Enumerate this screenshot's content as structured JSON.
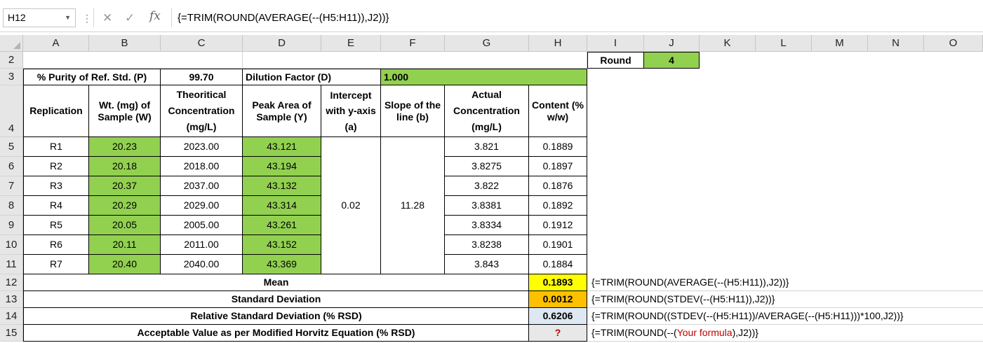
{
  "formula_bar": {
    "name_box": "H12",
    "fx_label": "fx",
    "formula": "{=TRIM(ROUND(AVERAGE(--(H5:H11)),J2))}"
  },
  "columns": [
    "A",
    "B",
    "C",
    "D",
    "E",
    "F",
    "G",
    "H",
    "I",
    "J",
    "K",
    "L",
    "M",
    "N",
    "O"
  ],
  "rows": [
    "2",
    "3",
    "4",
    "5",
    "6",
    "7",
    "8",
    "9",
    "10",
    "11",
    "12",
    "13",
    "14",
    "15"
  ],
  "round": {
    "label": "Round",
    "value": "4"
  },
  "purity": {
    "label": "% Purity of Ref. Std. (P)",
    "value": "99.70"
  },
  "dilution": {
    "label": "Dilution Factor (D)",
    "value": "1.000"
  },
  "headers": {
    "replication": "Replication",
    "weight": "Wt. (mg) of Sample (W)",
    "theoretical": "Theoritical Concentration (mg/L)",
    "peak_area": "Peak Area of Sample (Y)",
    "intercept": "Intercept with y-axis (a)",
    "slope": "Slope of the line (b)",
    "actual": "Actual Concentration (mg/L)",
    "content": "Content (% w/w)"
  },
  "data_rows": [
    {
      "rep": "R1",
      "wt": "20.23",
      "theo": "2023.00",
      "peak": "43.121",
      "actual": "3.821",
      "content": "0.1889"
    },
    {
      "rep": "R2",
      "wt": "20.18",
      "theo": "2018.00",
      "peak": "43.194",
      "actual": "3.8275",
      "content": "0.1897"
    },
    {
      "rep": "R3",
      "wt": "20.37",
      "theo": "2037.00",
      "peak": "43.132",
      "actual": "3.822",
      "content": "0.1876"
    },
    {
      "rep": "R4",
      "wt": "20.29",
      "theo": "2029.00",
      "peak": "43.314",
      "actual": "3.8381",
      "content": "0.1892"
    },
    {
      "rep": "R5",
      "wt": "20.05",
      "theo": "2005.00",
      "peak": "43.261",
      "actual": "3.8334",
      "content": "0.1912"
    },
    {
      "rep": "R6",
      "wt": "20.11",
      "theo": "2011.00",
      "peak": "43.152",
      "actual": "3.8238",
      "content": "0.1901"
    },
    {
      "rep": "R7",
      "wt": "20.40",
      "theo": "2040.00",
      "peak": "43.369",
      "actual": "3.843",
      "content": "0.1884"
    }
  ],
  "intercept_value": "0.02",
  "slope_value": "11.28",
  "summary": [
    {
      "label": "Mean",
      "value": "0.1893",
      "formula": "{=TRIM(ROUND(AVERAGE(--(H5:H11)),J2))}"
    },
    {
      "label": "Standard Deviation",
      "value": "0.0012",
      "formula": "{=TRIM(ROUND(STDEV(--(H5:H11)),J2))}"
    },
    {
      "label": "Relative Standard Deviation (% RSD)",
      "value": "0.6206",
      "formula": "{=TRIM(ROUND((STDEV(--(H5:H11))/AVERAGE(--(H5:H11)))*100,J2))}"
    },
    {
      "label": "Acceptable Value as per Modified Horvitz Equation (% RSD)",
      "value": "?",
      "formula_pre": "{=TRIM(ROUND(--(",
      "formula_red": "Your formula",
      "formula_post": "),J2))}"
    }
  ],
  "colors": {
    "green": "#92d050",
    "yellow": "#ffff00",
    "orange": "#ffc000",
    "light_blue": "#dde8f3",
    "red_text": "#c00000"
  }
}
